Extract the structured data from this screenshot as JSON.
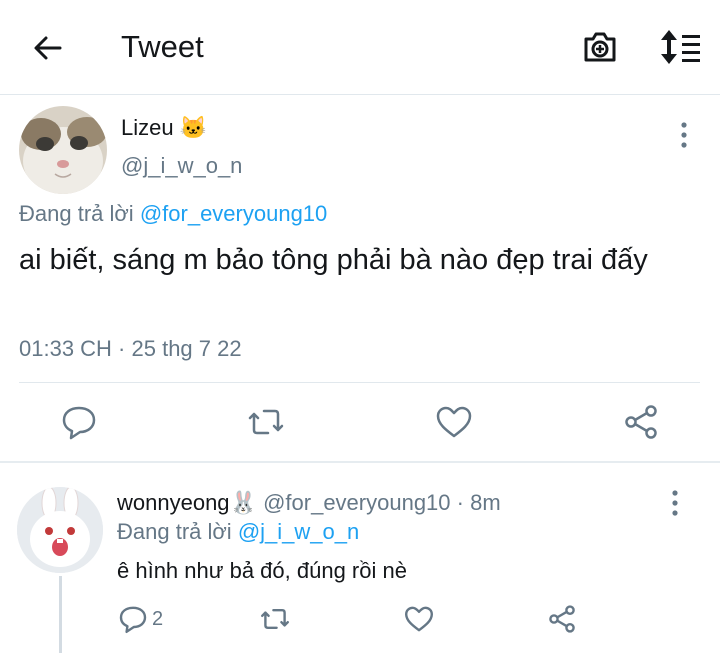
{
  "header": {
    "title": "Tweet",
    "back_icon": "back-arrow-icon",
    "camera_icon": "camera-icon",
    "sort_icon": "sort-icon"
  },
  "main_tweet": {
    "author_name": "Lizeu",
    "author_emoji": "🐱",
    "author_handle": "@j_i_w_o_n",
    "replying_label": "Đang trả lời",
    "replying_to": "@for_everyoung10",
    "text": "ai biết, sáng m bảo tông phải bà nào đẹp trai đấy",
    "timestamp": "01:33 CH · 25 thg 7 22"
  },
  "reply_tweet": {
    "author_name": "wonnyeong",
    "author_emoji": "🐰",
    "author_handle": "@for_everyoung10",
    "time_ago": "· 8m",
    "replying_label": "Đang trả lời",
    "replying_to": "@j_i_w_o_n",
    "text": "ê hình như bả đó, đúng rồi nè",
    "reply_count": "2"
  },
  "colors": {
    "accent": "#1da1f2",
    "muted": "#657786",
    "text": "#14171a",
    "divider": "#e1e8ed"
  }
}
